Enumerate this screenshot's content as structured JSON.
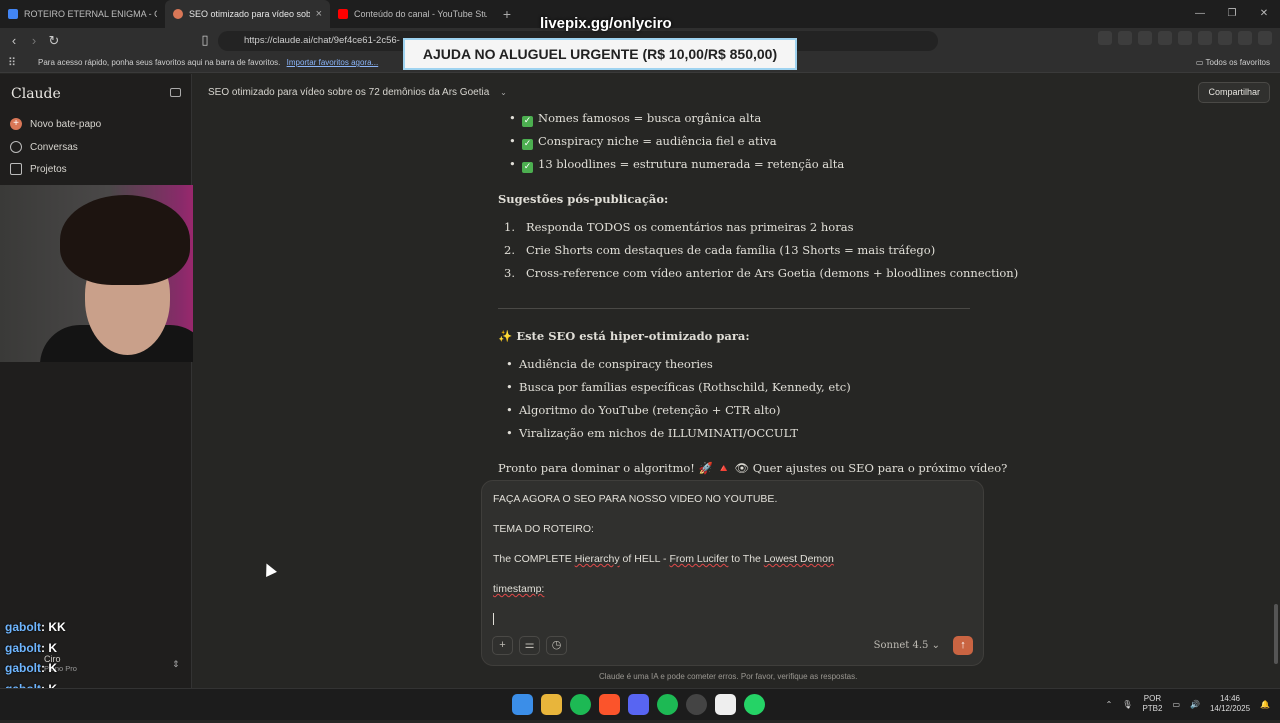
{
  "browser": {
    "tabs": [
      {
        "title": "ROTEIRO ETERNAL ENIGMA - Google",
        "icon": "google-docs-icon",
        "color": "#4285f4",
        "active": false
      },
      {
        "title": "SEO otimizado para vídeo sobre",
        "icon": "claude-icon",
        "color": "#d97757",
        "active": true,
        "close": "×"
      },
      {
        "title": "Conteúdo do canal - YouTube Studio",
        "icon": "youtube-icon",
        "color": "#ff0000",
        "active": false
      }
    ],
    "new_tab": "+",
    "url": "https://claude.ai/chat/9ef4ce61-2c56-",
    "bookmarks_hint": "Para acesso rápido, ponha seus favoritos aqui na barra de favoritos.",
    "import_link": "Importar favoritos agora...",
    "all_favorites": "Todos os favoritos"
  },
  "overlay": {
    "url_text": "livepix.gg/onlyciro",
    "banner": "AJUDA NO ALUGUEL URGENTE (R$ 10,00/R$ 850,00)"
  },
  "sidebar": {
    "brand": "Claude",
    "items": [
      {
        "label": "Novo bate-papo",
        "icon": "plus-icon"
      },
      {
        "label": "Conversas",
        "icon": "chat-icon"
      },
      {
        "label": "Projetos",
        "icon": "folder-icon"
      }
    ],
    "account_name": "Ciro",
    "account_plan": "Plano Pro"
  },
  "stream_chat": [
    {
      "user": "gabolt",
      "msg": ": KK"
    },
    {
      "user": "gabolt",
      "msg": ": K"
    },
    {
      "user": "gabolt",
      "msg": ": K"
    },
    {
      "user": "gabolt",
      "msg": ": K"
    },
    {
      "user": "gabolt",
      "msg": ": K"
    }
  ],
  "main": {
    "conversation_title": "SEO otimizado para vídeo sobre os 72 demônios da Ars Goetia",
    "share_label": "Compartilhar",
    "checklist": [
      "Nomes famosos = busca orgânica alta",
      "Conspiracy niche = audiência fiel e ativa",
      "13 bloodlines = estrutura numerada = retenção alta"
    ],
    "post_heading": "Sugestões pós-publicação:",
    "post_items": [
      "Responda TODOS os comentários nas primeiras 2 horas",
      "Crie Shorts com destaques de cada família (13 Shorts = mais tráfego)",
      "Cross-reference com vídeo anterior de Ars Goetia (demons + bloodlines connection)"
    ],
    "optimized_heading": "✨ Este SEO está hiper-otimizado para:",
    "optimized_items": [
      "Audiência de conspiracy theories",
      "Busca por famílias específicas (Rothschild, Kennedy, etc)",
      "Algoritmo do YouTube (retenção + CTR alto)",
      "Viralização em nichos de ILLUMINATI/OCCULT"
    ],
    "closing": "Pronto para dominar o algoritmo! 🚀 🔺 👁 Quer ajustes ou SEO para o próximo vídeo?"
  },
  "composer": {
    "line1": "FAÇA AGORA O SEO PARA NOSSO VIDEO NO YOUTUBE.",
    "line2": "TEMA DO ROTEIRO:",
    "line3_a": "The COMPLETE ",
    "line3_b": "Hierarchy",
    "line3_c": " of HELL - ",
    "line3_d": "From Lucifer",
    "line3_e": " to The ",
    "line3_f": "Lowest Demon",
    "line4": "timestamp:",
    "model": "Sonnet 4.5",
    "model_chevron": "⌄",
    "add": "+",
    "tools": "⚌",
    "history": "◷",
    "send": "↑"
  },
  "disclaimer": "Claude é uma IA e pode cometer erros. Por favor, verifique as respostas.",
  "taskbar": {
    "lang1": "POR",
    "lang2": "PTB2",
    "time": "14:46",
    "date": "14/12/2025"
  }
}
